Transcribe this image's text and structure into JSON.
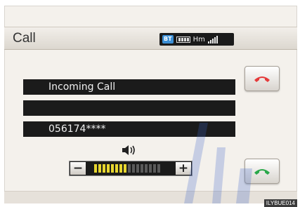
{
  "header": {
    "title": "Call"
  },
  "status": {
    "bt": "BT",
    "hm": "Hm"
  },
  "info_rows": [
    {
      "text": "Incoming Call"
    },
    {
      "text": ""
    },
    {
      "text": "056174****"
    }
  ],
  "volume": {
    "minus": "−",
    "plus": "+",
    "segments_on": 8,
    "segments_total": 16
  },
  "footer": {
    "code": "ILYBUE014"
  },
  "colors": {
    "hangup": "#e53a3a",
    "answer": "#2aa84a",
    "accent": "#3b8fd6"
  }
}
